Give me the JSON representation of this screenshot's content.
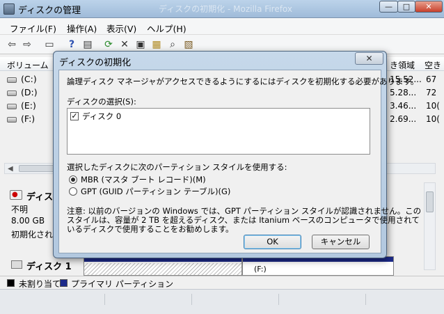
{
  "window": {
    "title": "ディスクの管理",
    "ghost_title": "ディスクの初期化 - Mozilla Firefox",
    "min_glyph": "—",
    "max_glyph": "□",
    "close_glyph": "✕"
  },
  "menu": [
    "ファイル(F)",
    "操作(A)",
    "表示(V)",
    "ヘルプ(H)"
  ],
  "toolbar": {
    "icons": [
      "back-arrow-icon",
      "forward-arrow-icon",
      "pane-icon",
      "help-icon",
      "view-icon",
      "refresh-icon",
      "delete-icon",
      "properties-icon",
      "open-icon",
      "search-icon",
      "wizard-icon"
    ],
    "glyphs": [
      "⇦",
      "⇨",
      "▭",
      "?",
      "▤",
      "⟳",
      "✕",
      "▣",
      "▦",
      "⌕",
      "▧"
    ]
  },
  "volume_list": {
    "header_label": "ボリューム",
    "columns": [
      "き領域",
      "空き"
    ],
    "rows": [
      {
        "name": "(C:)",
        "free": "15.52...",
        "pct": "67"
      },
      {
        "name": "(D:)",
        "free": "5.28...",
        "pct": "72"
      },
      {
        "name": "(E:)",
        "free": "3.46...",
        "pct": "10("
      },
      {
        "name": "(F:)",
        "free": "2.69...",
        "pct": "10("
      }
    ]
  },
  "disk_pane": {
    "disk0_title": "ディス",
    "disk0_status": "不明",
    "disk0_size": "8.00 GB",
    "disk0_init": "初期化され",
    "disk1_title": "ディスク 1",
    "part_label": "(F:)"
  },
  "legend": {
    "unallocated": "未割り当て",
    "primary": "プライマリ パーティション",
    "colors": {
      "unallocated": "#000000",
      "primary": "#1c2a8a"
    }
  },
  "dialog": {
    "title": "ディスクの初期化",
    "close_glyph": "✕",
    "message": "論理ディスク マネージャがアクセスできるようにするにはディスクを初期化する必要があります。",
    "select_label": "ディスクの選択(S):",
    "disks": [
      {
        "label": "ディスク 0",
        "checked": true
      }
    ],
    "style_label": "選択したディスクに次のパーティション スタイルを使用する:",
    "options": [
      {
        "label": "MBR (マスタ ブート レコード)(M)",
        "selected": true
      },
      {
        "label": "GPT (GUID パーティション テーブル)(G)",
        "selected": false
      }
    ],
    "note_lines": [
      "注意: 以前のバージョンの Windows では、GPT パーティション スタイルが認識されません。この",
      "スタイルは、容量が 2 TB を超えるディスク、または Itanium ベースのコンピュータで使用されて",
      "いるディスクで使用することをお勧めします。"
    ],
    "ok_label": "OK",
    "cancel_label": "キャンセル"
  }
}
